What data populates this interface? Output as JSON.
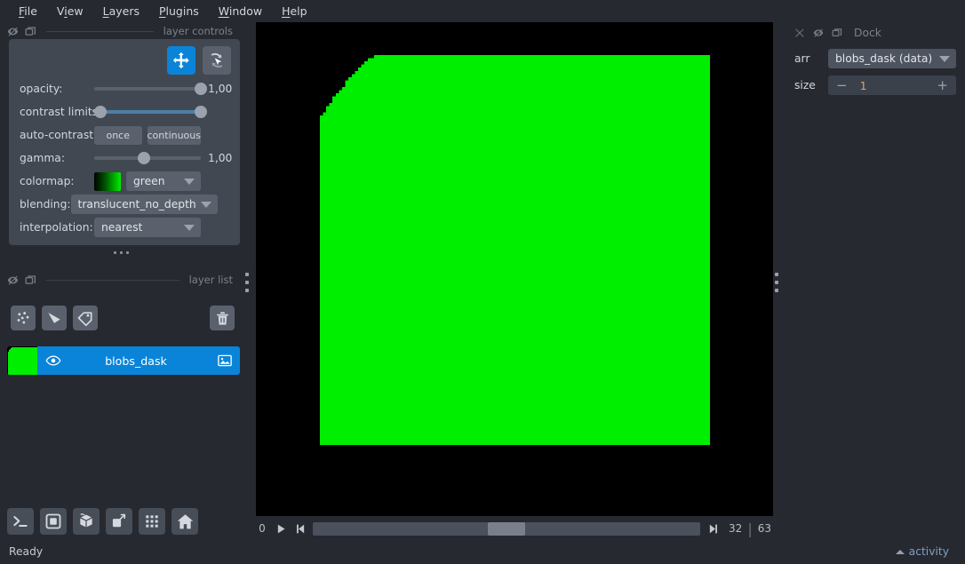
{
  "menubar": {
    "items": [
      {
        "label": "File",
        "mnemonic": "F"
      },
      {
        "label": "View",
        "mnemonic": "V"
      },
      {
        "label": "Layers",
        "mnemonic": "L"
      },
      {
        "label": "Plugins",
        "mnemonic": "P"
      },
      {
        "label": "Window",
        "mnemonic": "W"
      },
      {
        "label": "Help",
        "mnemonic": "H"
      }
    ]
  },
  "layer_controls": {
    "section_title": "layer controls",
    "tools": [
      {
        "name": "pan-zoom-tool",
        "active": true
      },
      {
        "name": "transform-tool",
        "active": false
      }
    ],
    "opacity": {
      "label": "opacity:",
      "value": "1,00",
      "percent": 100
    },
    "contrast_limits": {
      "label": "contrast limits:",
      "low_percent": 0,
      "high_percent": 100
    },
    "auto_contrast": {
      "label": "auto-contrast:",
      "once": "once",
      "continuous": "continuous"
    },
    "gamma": {
      "label": "gamma:",
      "value": "1,00",
      "percent": 50
    },
    "colormap": {
      "label": "colormap:",
      "value": "green",
      "swatch_start": "#000000",
      "swatch_end": "#00ee00"
    },
    "blending": {
      "label": "blending:",
      "value": "translucent_no_depth"
    },
    "interpolation": {
      "label": "interpolation:",
      "value": "nearest"
    }
  },
  "layer_list": {
    "section_title": "layer list",
    "buttons": [
      {
        "name": "new-points-button"
      },
      {
        "name": "new-shapes-button"
      },
      {
        "name": "new-labels-button"
      }
    ],
    "delete_button": "delete-layer-button",
    "layers": [
      {
        "name": "blobs_dask",
        "visible": true,
        "selected": true,
        "type": "image"
      }
    ]
  },
  "bottom_toolbar": {
    "buttons": [
      {
        "name": "console-button"
      },
      {
        "name": "ndisplay-2d-button"
      },
      {
        "name": "ndisplay-3d-button"
      },
      {
        "name": "roll-dims-button"
      },
      {
        "name": "grid-view-button"
      },
      {
        "name": "reset-view-button"
      }
    ]
  },
  "canvas": {
    "background": "#000000",
    "blob_color": "#00ee00",
    "seed": 20250411
  },
  "dims_slider": {
    "axis_label": "0",
    "play_button": "play-button",
    "first_button": "first-frame-button",
    "last_button": "last-frame-button",
    "current": "32",
    "separator": "|",
    "max": "63",
    "position_percent": 50
  },
  "dock": {
    "title": "Dock",
    "close_icon": "close-icon",
    "hide_icon": "eye-slash-icon",
    "float_icon": "float-icon",
    "fields": [
      {
        "name": "arr",
        "label": "arr",
        "type": "combobox",
        "value": "blobs_dask (data)"
      },
      {
        "name": "size",
        "label": "size",
        "type": "spinbox",
        "value": "1",
        "minus": "−",
        "plus": "+"
      }
    ]
  },
  "statusbar": {
    "message": "Ready",
    "activity_label": "activity"
  }
}
